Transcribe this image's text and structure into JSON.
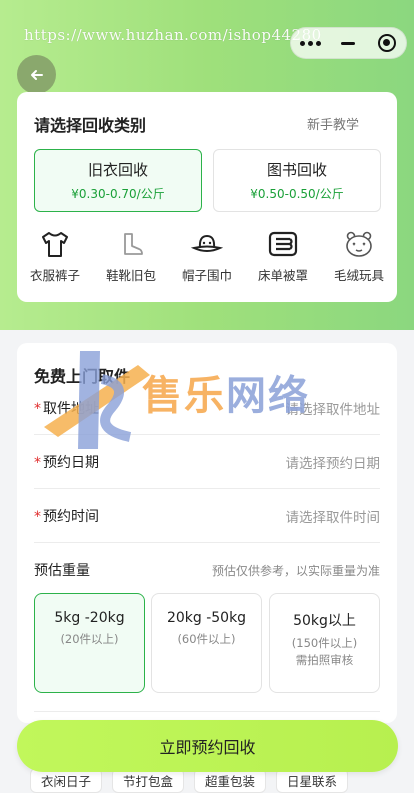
{
  "watermark": {
    "url": "https://www.huzhan.com/ishop44280",
    "logo_text_left": "售乐",
    "logo_text_right": "网络"
  },
  "header": {
    "menu_icon": "more-dots-icon",
    "minimize_icon": "minus-icon",
    "close_icon": "target-icon",
    "back_icon": "arrow-left-icon"
  },
  "category_card": {
    "title": "请选择回收类别",
    "tutorial_link": "新手教学",
    "categories": [
      {
        "name": "旧衣回收",
        "price": "¥0.30-0.70/公斤",
        "selected": true
      },
      {
        "name": "图书回收",
        "price": "¥0.50-0.50/公斤",
        "selected": false
      }
    ],
    "items": [
      {
        "icon": "tshirt-icon",
        "label": "衣服裤子"
      },
      {
        "icon": "boot-icon",
        "label": "鞋靴旧包"
      },
      {
        "icon": "hat-icon",
        "label": "帽子围巾"
      },
      {
        "icon": "bedding-icon",
        "label": "床单被罩"
      },
      {
        "icon": "plush-toy-icon",
        "label": "毛绒玩具"
      }
    ]
  },
  "pickup_card": {
    "title": "免费上门取件",
    "fields": [
      {
        "label": "取件地址",
        "placeholder": "请选择取件地址",
        "required": true
      },
      {
        "label": "预约日期",
        "placeholder": "请选择预约日期",
        "required": true
      },
      {
        "label": "预约时间",
        "placeholder": "请选择取件时间",
        "required": true
      }
    ],
    "weight": {
      "label": "预估重量",
      "tip": "预估仅供参考，以实际重量为准",
      "options": [
        {
          "weight": "5kg -20kg",
          "sub": "(20件以上)",
          "sub2": "",
          "selected": true
        },
        {
          "weight": "20kg -50kg",
          "sub": "(60件以上)",
          "sub2": "",
          "selected": false
        },
        {
          "weight": "50kg以上",
          "sub": "(150件以上)",
          "sub2": "需拍照审核",
          "selected": false
        }
      ]
    }
  },
  "bottom_tags": [
    "衣闲日子",
    "节打包盒",
    "超重包装",
    "日星联系"
  ],
  "cta": {
    "label": "立即预约回收"
  },
  "colors": {
    "accent_green": "#2cb24a",
    "price_green": "#1aa038",
    "cta_lime": "#c1f75b",
    "required_red": "#e02c2c"
  }
}
